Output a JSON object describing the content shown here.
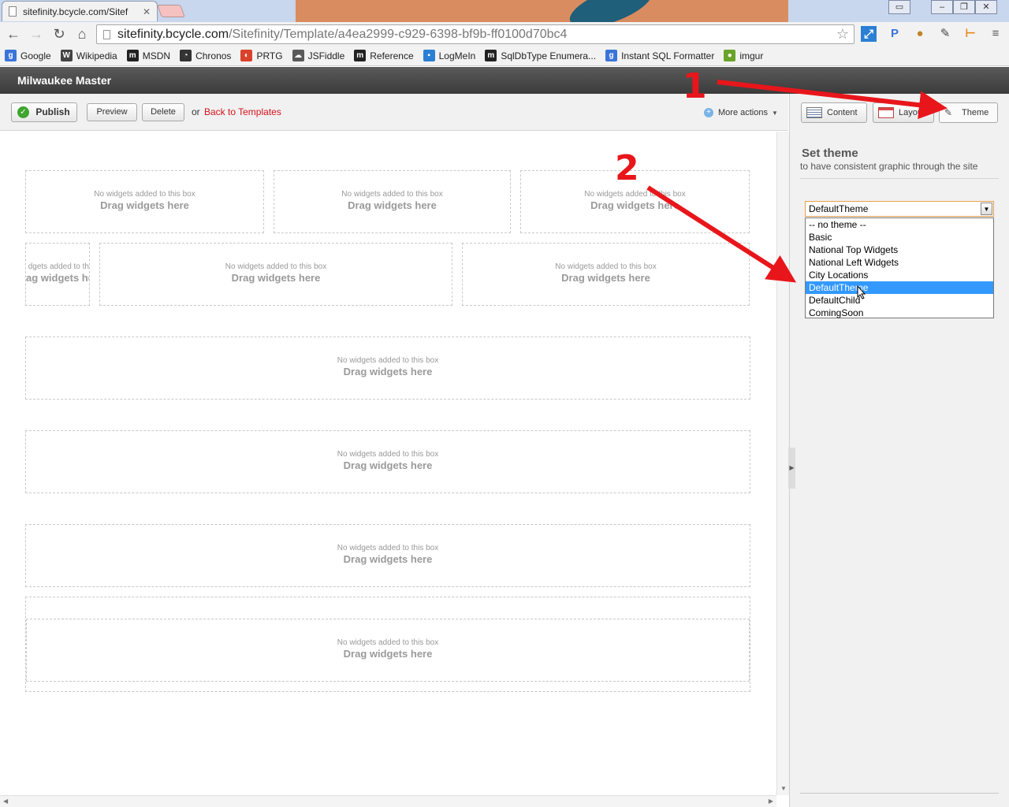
{
  "browser": {
    "tab_title": "sitefinity.bcycle.com/Sitef",
    "url_host": "sitefinity.bcycle.com",
    "url_path": "/Sitefinity/Template/a4ea2999-c929-6398-bf9b-ff0100d70bc4",
    "bookmarks": [
      {
        "label": "Google",
        "icon": "google-icon",
        "color": "#3b74d9"
      },
      {
        "label": "Wikipedia",
        "icon": "wikipedia-icon",
        "color": "#444444"
      },
      {
        "label": "MSDN",
        "icon": "m-icon",
        "color": "#222222"
      },
      {
        "label": "Chronos",
        "icon": "clock-icon",
        "color": "#333333"
      },
      {
        "label": "PRTG",
        "icon": "gauge-icon",
        "color": "#d9432b"
      },
      {
        "label": "JSFiddle",
        "icon": "cloud-icon",
        "color": "#5a5a5a"
      },
      {
        "label": "Reference",
        "icon": "m-icon",
        "color": "#222222"
      },
      {
        "label": "LogMeIn",
        "icon": "logmein-icon",
        "color": "#2a7fd4"
      },
      {
        "label": "SqlDbType Enumera...",
        "icon": "m-icon",
        "color": "#222222"
      },
      {
        "label": "Instant SQL Formatter",
        "icon": "google-icon",
        "color": "#3b74d9"
      },
      {
        "label": "imgur",
        "icon": "imgur-icon",
        "color": "#6aa329"
      }
    ]
  },
  "cms": {
    "site_name": "Milwaukee Master",
    "publish_label": "Publish",
    "preview_label": "Preview",
    "delete_label": "Delete",
    "or_text": "or",
    "back_link": "Back to Templates",
    "more_actions": "More actions"
  },
  "panel": {
    "tabs": {
      "content": "Content",
      "layout": "Layout",
      "theme": "Theme"
    },
    "set_theme_title": "Set theme",
    "set_theme_sub": "to have consistent graphic through the site",
    "selected_value": "DefaultTheme",
    "options": [
      "-- no theme --",
      "Basic",
      "National Top Widgets",
      "National Left Widgets",
      "City Locations",
      "DefaultTheme",
      "DefaultChild",
      "ComingSoon"
    ],
    "highlighted_index": 5
  },
  "drop_zone": {
    "hint": "No widgets added to this box",
    "drag": "Drag widgets here",
    "partial_hint": "dgets added to th",
    "partial_drag": "ag widgets he"
  },
  "annotations": {
    "step1": "1",
    "step2": "2",
    "color": "#e8161b"
  }
}
